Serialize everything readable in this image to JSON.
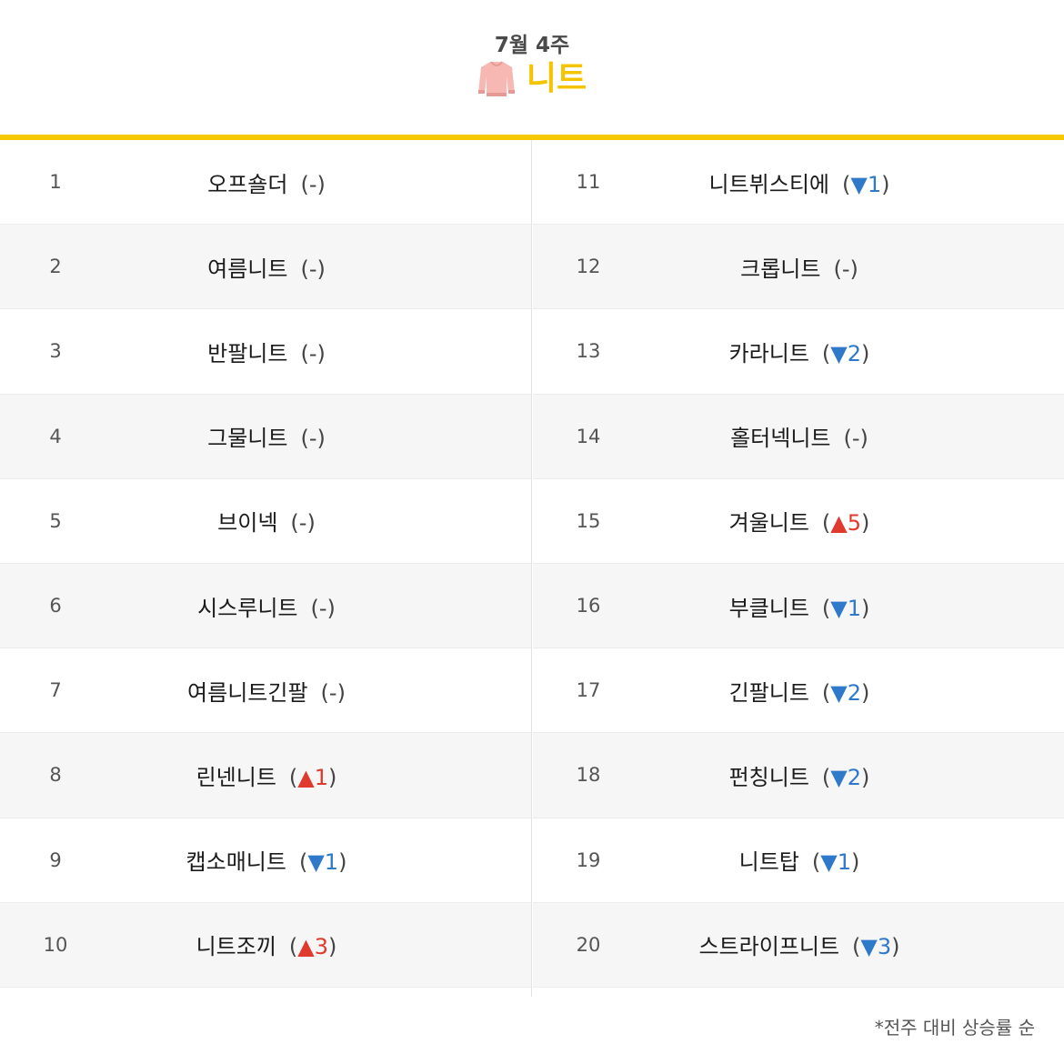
{
  "header": {
    "week": "7월 4주",
    "category": "니트",
    "icon": "sweater-icon"
  },
  "colors": {
    "accent": "#f5c800",
    "up": "#e03a2e",
    "down": "#2e79c9"
  },
  "rankings": [
    {
      "rank": "1",
      "keyword": "오프숄더",
      "change": "-",
      "dir": "none"
    },
    {
      "rank": "2",
      "keyword": "여름니트",
      "change": "-",
      "dir": "none"
    },
    {
      "rank": "3",
      "keyword": "반팔니트",
      "change": "-",
      "dir": "none"
    },
    {
      "rank": "4",
      "keyword": "그물니트",
      "change": "-",
      "dir": "none"
    },
    {
      "rank": "5",
      "keyword": "브이넥",
      "change": "-",
      "dir": "none"
    },
    {
      "rank": "6",
      "keyword": "시스루니트",
      "change": "-",
      "dir": "none"
    },
    {
      "rank": "7",
      "keyword": "여름니트긴팔",
      "change": "-",
      "dir": "none"
    },
    {
      "rank": "8",
      "keyword": "린넨니트",
      "change": "▲1",
      "dir": "up"
    },
    {
      "rank": "9",
      "keyword": "캡소매니트",
      "change": "▼1",
      "dir": "down"
    },
    {
      "rank": "10",
      "keyword": "니트조끼",
      "change": "▲3",
      "dir": "up"
    },
    {
      "rank": "11",
      "keyword": "니트뷔스티에",
      "change": "▼1",
      "dir": "down"
    },
    {
      "rank": "12",
      "keyword": "크롭니트",
      "change": "-",
      "dir": "none"
    },
    {
      "rank": "13",
      "keyword": "카라니트",
      "change": "▼2",
      "dir": "down"
    },
    {
      "rank": "14",
      "keyword": "홀터넥니트",
      "change": "-",
      "dir": "none"
    },
    {
      "rank": "15",
      "keyword": "겨울니트",
      "change": "▲5",
      "dir": "up"
    },
    {
      "rank": "16",
      "keyword": "부클니트",
      "change": "▼1",
      "dir": "down"
    },
    {
      "rank": "17",
      "keyword": "긴팔니트",
      "change": "▼2",
      "dir": "down"
    },
    {
      "rank": "18",
      "keyword": "펀칭니트",
      "change": "▼2",
      "dir": "down"
    },
    {
      "rank": "19",
      "keyword": "니트탑",
      "change": "▼1",
      "dir": "down"
    },
    {
      "rank": "20",
      "keyword": "스트라이프니트",
      "change": "▼3",
      "dir": "down"
    }
  ],
  "footnote": "*전주 대비 상승률 순"
}
